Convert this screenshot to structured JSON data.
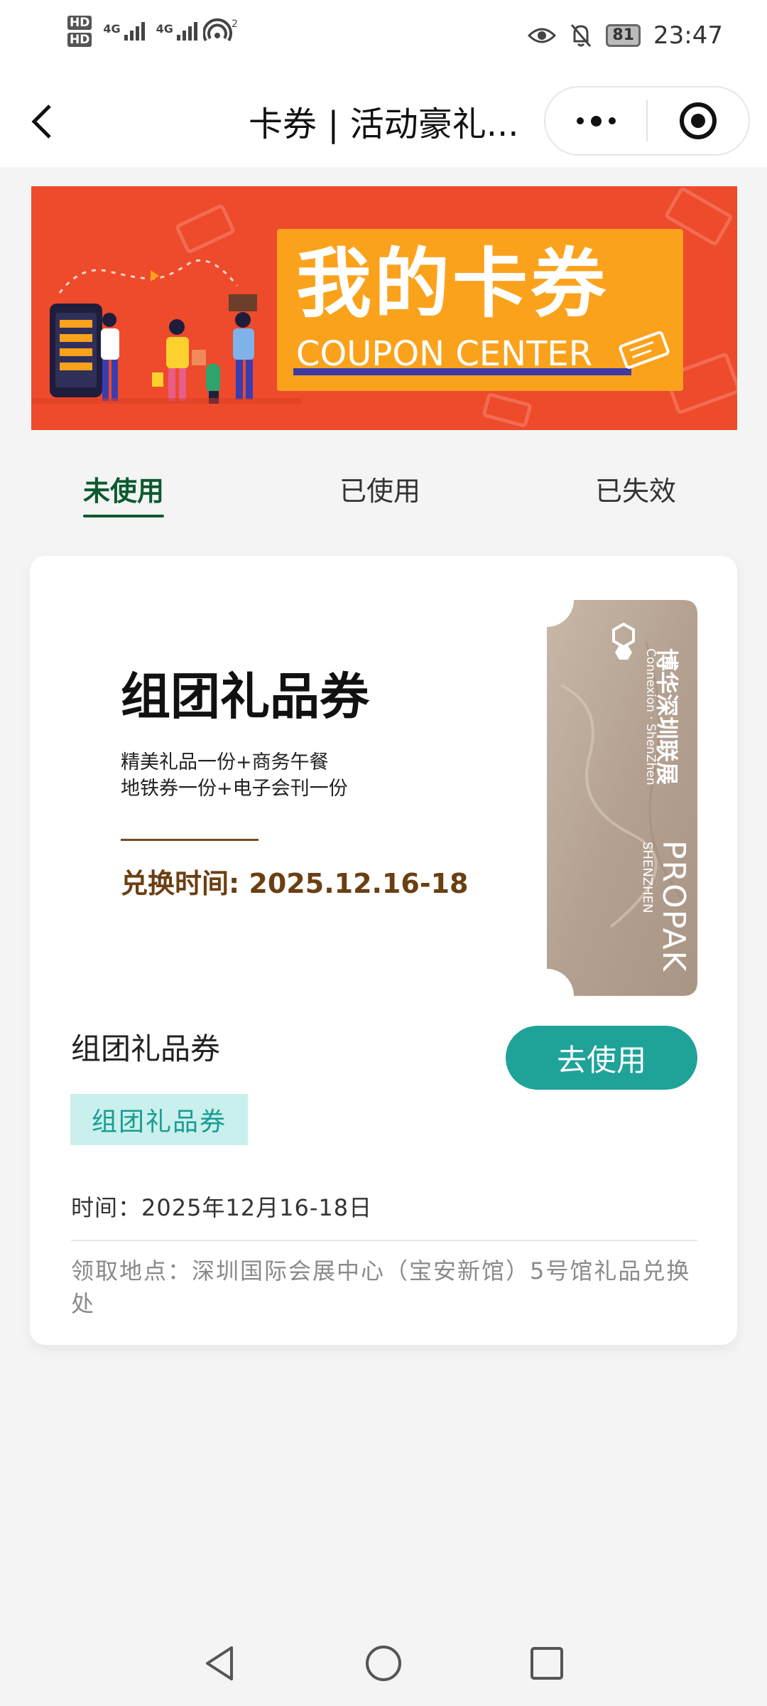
{
  "status_bar": {
    "hd1": "HD",
    "hd2": "HD",
    "net1": "4G",
    "net2": "4G",
    "battery": "81",
    "time": "23:47",
    "icons": [
      "hd-icon",
      "signal-icon",
      "wifi-hotspot-icon",
      "eye-icon",
      "mute-bell-icon",
      "battery-icon"
    ]
  },
  "nav": {
    "title": "卡券 | 活动豪礼...",
    "back_icon": "chevron-left-icon",
    "more_icon": "more-dots-icon",
    "close_icon": "target-close-icon"
  },
  "banner": {
    "title": "我的卡券",
    "subtitle": "COUPON CENTER",
    "colors": {
      "bg": "#ee4a2c",
      "box": "#fba21c",
      "underline": "#3d3aa6"
    }
  },
  "tabs": [
    {
      "label": "未使用",
      "active": true
    },
    {
      "label": "已使用",
      "active": false
    },
    {
      "label": "已失效",
      "active": false
    }
  ],
  "coupon": {
    "image": {
      "title": "组团礼品券",
      "desc_line1": "精美礼品一份+商务午餐",
      "desc_line2": "地铁券一份+电子会刊一份",
      "redeem_date": "兑换时间: 2025.12.16-18",
      "ticket_brand_cn": "博华深圳联展",
      "ticket_brand_en": "Connexion · ShenZhen",
      "ticket_logo": "PROPAK",
      "ticket_logo_sub": "SHENZHEN"
    },
    "name": "组团礼品券",
    "use_button": "去使用",
    "tag": "组团礼品券",
    "time": "时间：2025年12月16-18日",
    "place": "领取地点：深圳国际会展中心（宝安新馆）5号馆礼品兑换处",
    "colors": {
      "accent": "#1fa399",
      "tag_bg": "#c9f0ec",
      "date_brown": "#6b3f12"
    }
  },
  "system_nav": [
    "back-triangle-icon",
    "home-circle-icon",
    "recents-square-icon"
  ]
}
